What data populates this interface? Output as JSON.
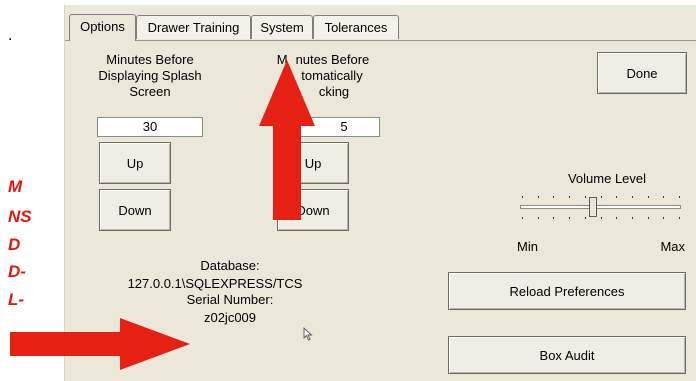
{
  "margin": {
    "dot": ".",
    "fragments": [
      "M",
      "NS",
      "D",
      "D-",
      "L-"
    ]
  },
  "tabs": [
    {
      "label": "Options",
      "active": true
    },
    {
      "label": "Drawer Training",
      "active": false
    },
    {
      "label": "System",
      "active": false
    },
    {
      "label": "Tolerances",
      "active": false
    }
  ],
  "splash": {
    "label_lines": [
      "Minutes Before",
      "Displaying Splash",
      "Screen"
    ],
    "value": "30",
    "up_label": "Up",
    "down_label": "Down"
  },
  "locking": {
    "label_lines": [
      "Minutes Before",
      "Automatically",
      "Locking"
    ],
    "visible_fragments": [
      "M",
      "nutes Before",
      "tomatically",
      "cking"
    ],
    "value": "5",
    "up_label": "Up",
    "down_label": "Down"
  },
  "done_label": "Done",
  "volume": {
    "label": "Volume Level",
    "min_label": "Min",
    "max_label": "Max",
    "level_fraction": 0.45
  },
  "database": {
    "label": "Database:",
    "value": "127.0.0.1\\SQLEXPRESS/TCS"
  },
  "serial": {
    "label": "Serial Number:",
    "value": "z02jc009"
  },
  "reload_label": "Reload Preferences",
  "box_audit_label": "Box Audit",
  "colors": {
    "window_bg": "#ebe8d9",
    "annotation_red": "#e62012"
  }
}
